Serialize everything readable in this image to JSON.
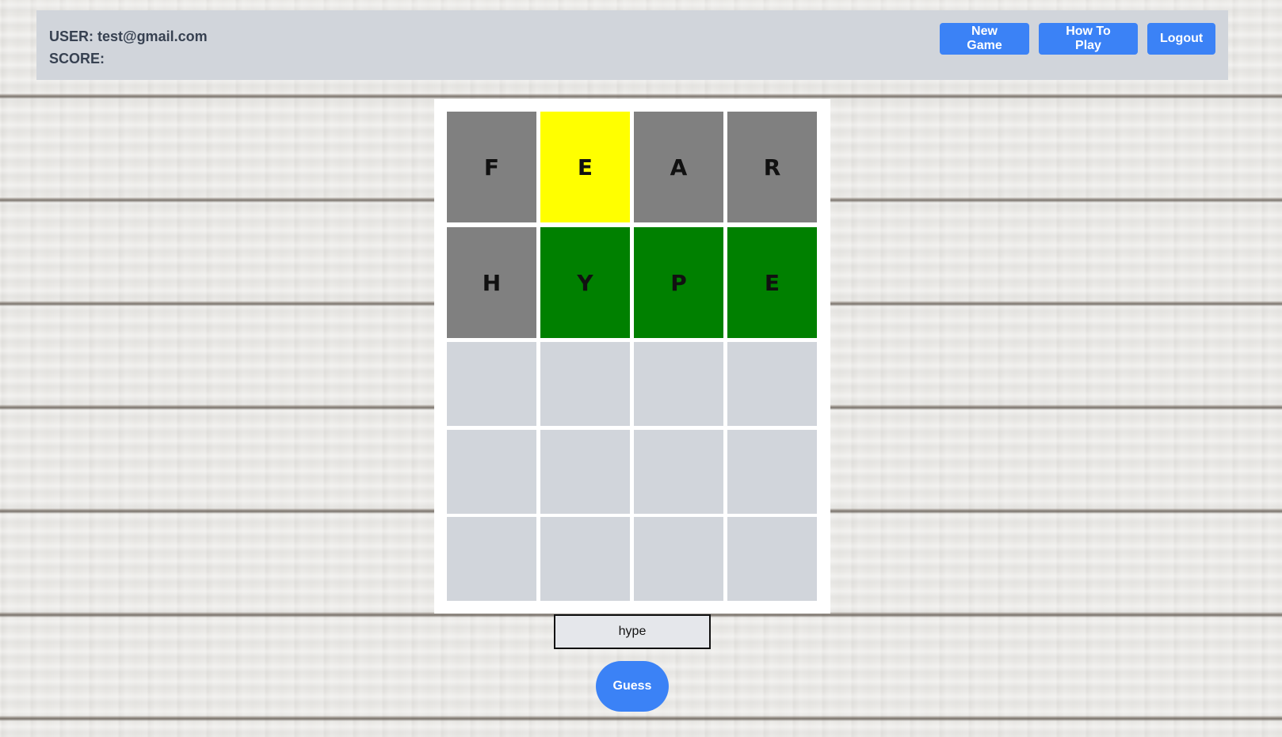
{
  "header": {
    "user_label": "USER: test@gmail.com",
    "score_label": "SCORE:",
    "buttons": {
      "new_game": "New Game",
      "how_to_play": "How To Play",
      "logout": "Logout"
    }
  },
  "board": {
    "rows": [
      [
        {
          "letter": "F",
          "state": "absent"
        },
        {
          "letter": "E",
          "state": "present"
        },
        {
          "letter": "A",
          "state": "absent"
        },
        {
          "letter": "R",
          "state": "absent"
        }
      ],
      [
        {
          "letter": "H",
          "state": "absent"
        },
        {
          "letter": "Y",
          "state": "correct"
        },
        {
          "letter": "P",
          "state": "correct"
        },
        {
          "letter": "E",
          "state": "correct"
        }
      ],
      [
        {
          "letter": "",
          "state": "empty"
        },
        {
          "letter": "",
          "state": "empty"
        },
        {
          "letter": "",
          "state": "empty"
        },
        {
          "letter": "",
          "state": "empty"
        }
      ],
      [
        {
          "letter": "",
          "state": "empty"
        },
        {
          "letter": "",
          "state": "empty"
        },
        {
          "letter": "",
          "state": "empty"
        },
        {
          "letter": "",
          "state": "empty"
        }
      ],
      [
        {
          "letter": "",
          "state": "empty"
        },
        {
          "letter": "",
          "state": "empty"
        },
        {
          "letter": "",
          "state": "empty"
        },
        {
          "letter": "",
          "state": "empty"
        }
      ]
    ]
  },
  "guess_input": {
    "value": "hype"
  },
  "guess_button": {
    "label": "Guess"
  },
  "colors": {
    "header_bg": "#d1d5db",
    "button_blue": "#3b82f6",
    "tile_absent": "#808080",
    "tile_present": "#ffff00",
    "tile_correct": "#008000",
    "tile_empty": "#d1d5db"
  }
}
